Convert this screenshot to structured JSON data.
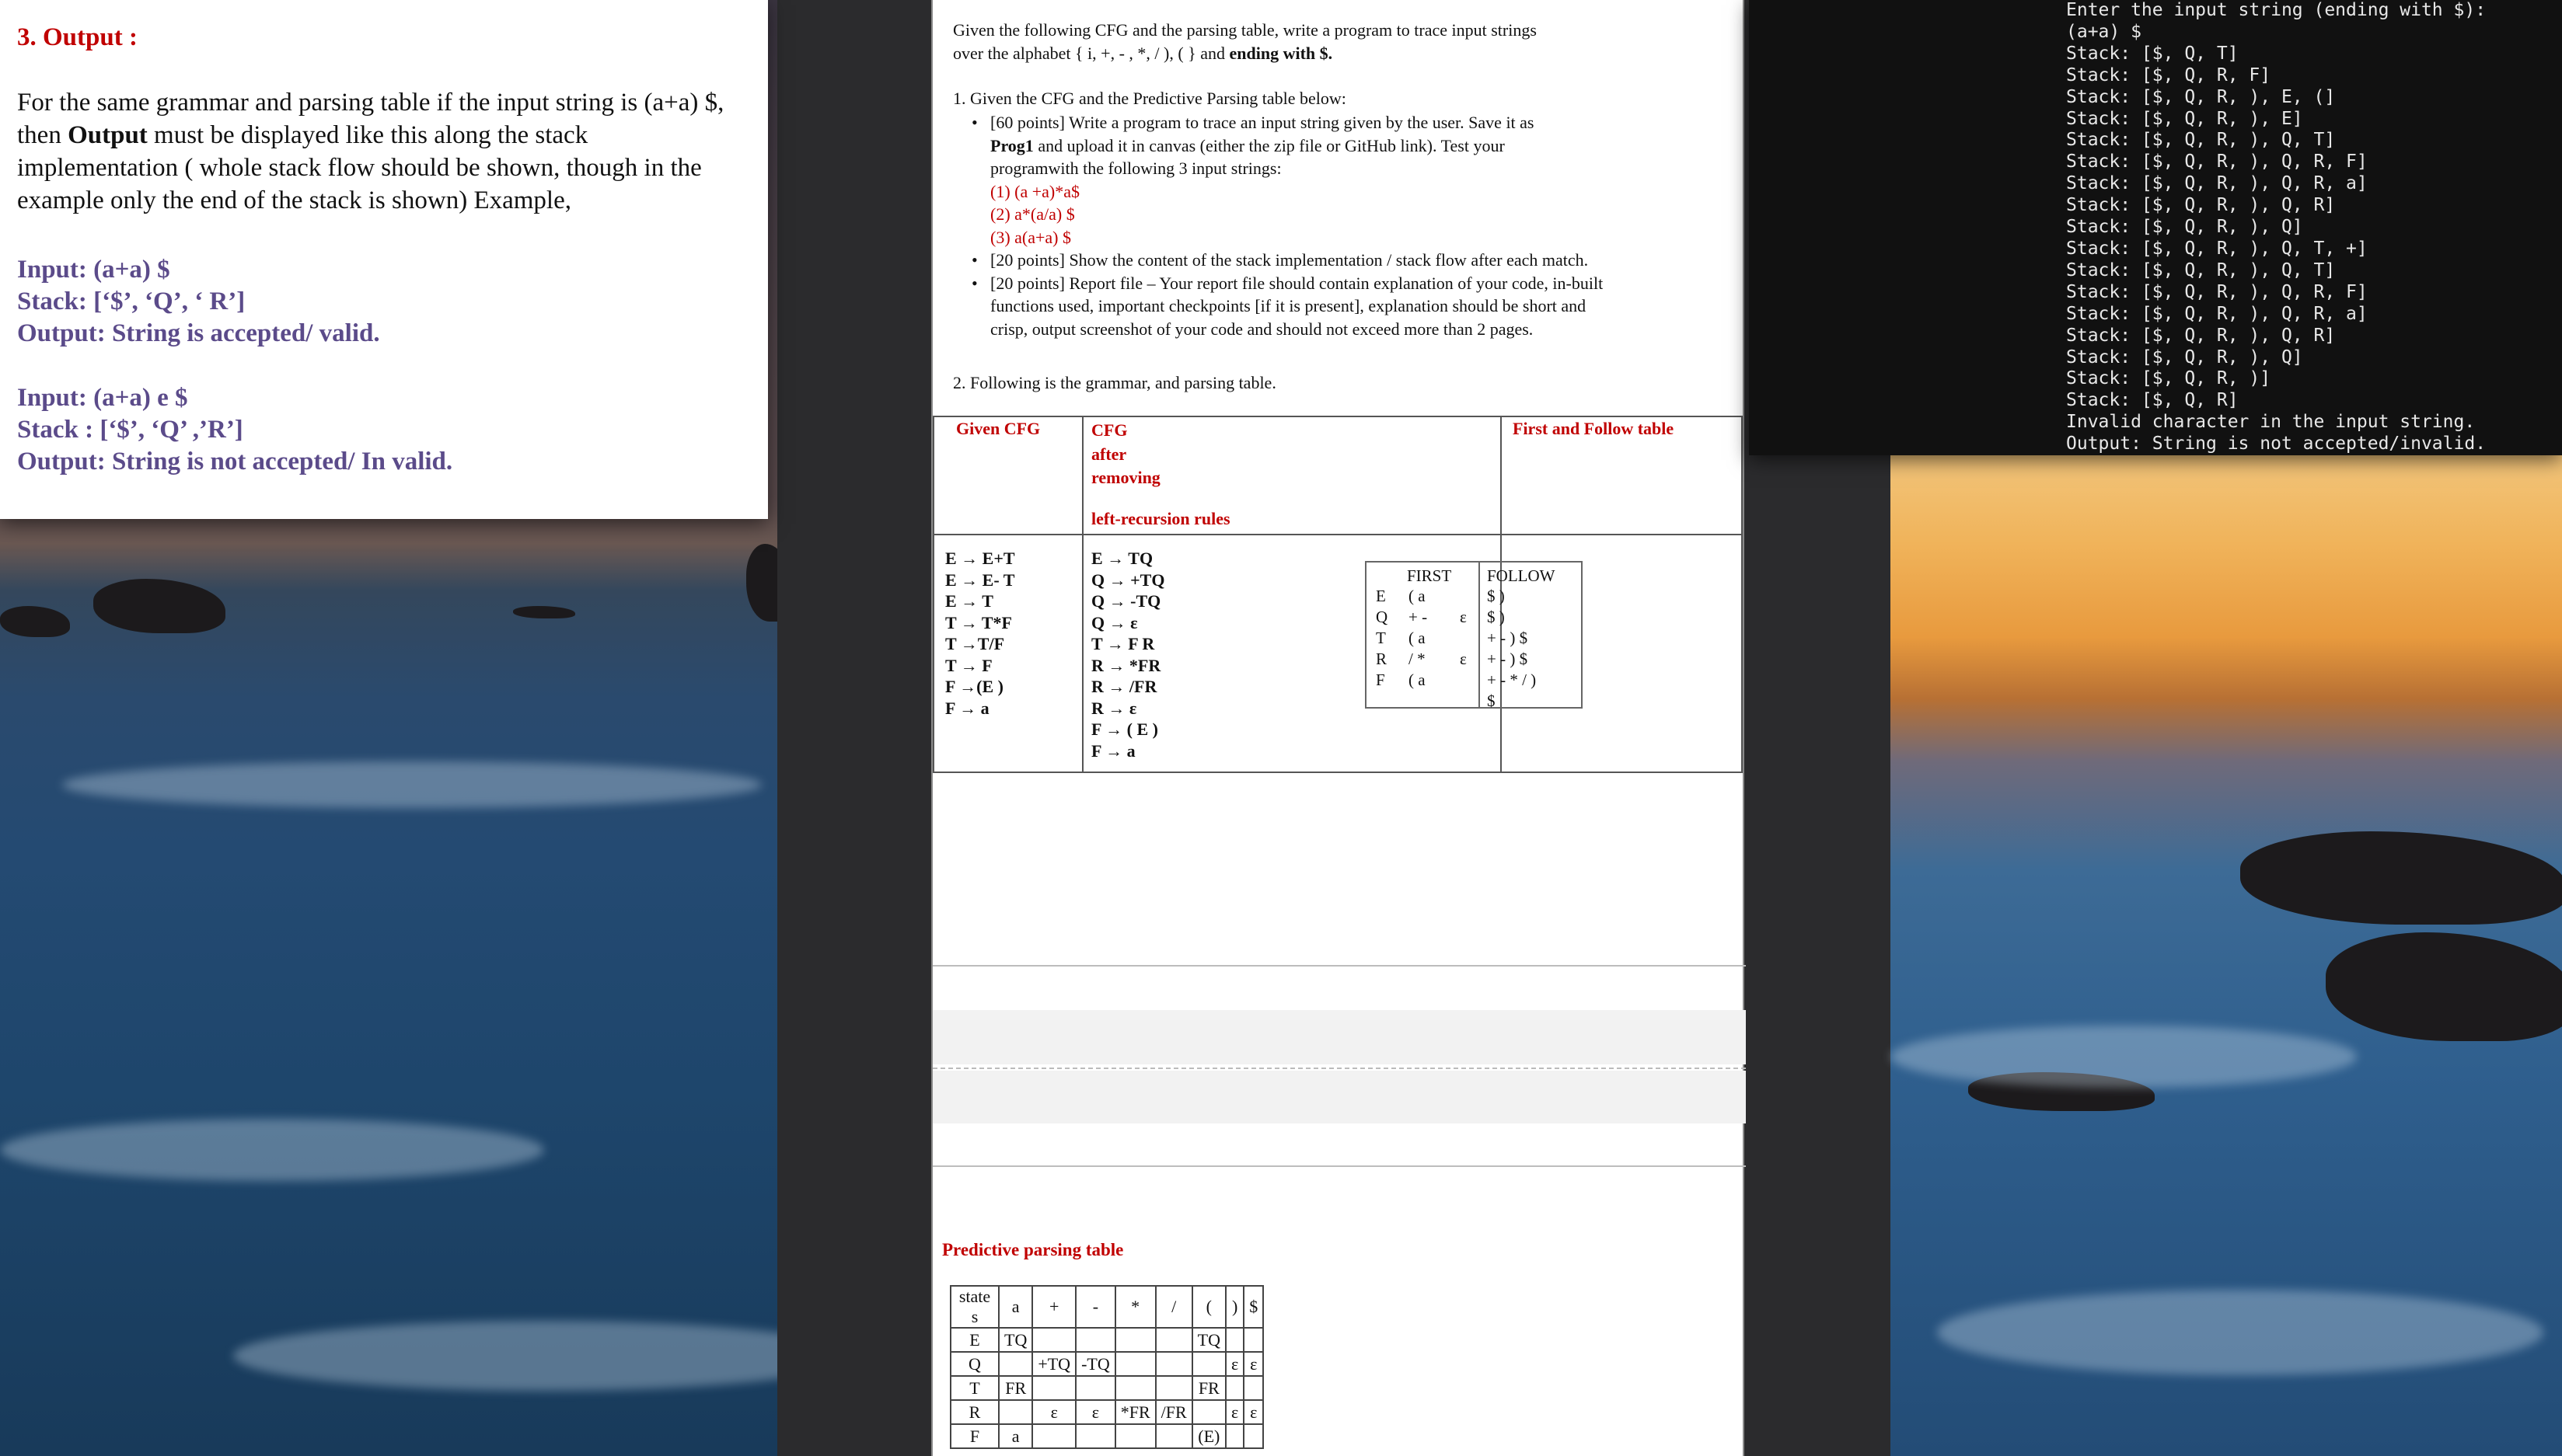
{
  "left_window": {
    "heading": "3. Output :",
    "paragraph_before": "For the same grammar and parsing table if the input string is (a+a) $, then ",
    "paragraph_bold": "Output",
    "paragraph_after": " must be displayed like this along the stack implementation ( whole stack flow should be shown, though in the example only the end of the stack is shown) Example,",
    "example1": {
      "input": "Input: (a+a) $",
      "stack": "Stack: [‘$’, ‘Q’, ‘ R’]",
      "output": "Output: String is accepted/ valid."
    },
    "example2": {
      "input": "Input: (a+a) e $",
      "stack": "Stack : [‘$’, ‘Q’ ,’R’]",
      "output": "Output: String is not accepted/ In valid."
    }
  },
  "document": {
    "intro_line1": "Given the following CFG and the parsing table, write a program to trace input strings",
    "intro_line2_pre": "over the alphabet { i, +, - , *, / ), ( } and ",
    "intro_line2_bold": "ending with $.",
    "q1_label": "1.  Given the CFG and the Predictive Parsing table below:",
    "bullet1_line1": "[60 points] Write a program to trace an input string given by the user. Save it as",
    "bullet1_line2_bold": "Prog1",
    "bullet1_line2_rest": " and upload it in canvas (either the zip file or GitHub link). Test your",
    "bullet1_line3": "programwith the following 3 input strings:",
    "test_strings": [
      "(1) (a +a)*a$",
      "(2) a*(a/a) $",
      "(3) a(a+a) $"
    ],
    "bullet2": "[20 points] Show the content of the stack implementation / stack flow after each match.",
    "bullet3_line1": "[20 points] Report file – Your report file should contain explanation of your code, in-built",
    "bullet3_line2": "functions used, important checkpoints [if it is present], explanation should be short and",
    "bullet3_line3": "crisp, output screenshot of your code and should not exceed more than 2 pages.",
    "q2_label": "2.  Following is the grammar, and parsing table.",
    "cfg_table": {
      "given_cfg_header": "Given CFG",
      "cfg_after_header": [
        "CFG",
        "after",
        "removing",
        "left-recursion rules"
      ],
      "ff_header": "First and Follow table",
      "given_cfg": [
        "E → E+T",
        "E → E- T",
        "E → T",
        "T → T*F",
        "T →T/F",
        "T → F",
        "F →(E )",
        "F → a"
      ],
      "cfg_after": [
        "E → TQ",
        "Q → +TQ",
        "Q → -TQ",
        "Q → ε",
        "T → F R",
        "R → *FR",
        "R → /FR",
        "R → ε",
        "F → ( E )",
        "F →  a"
      ],
      "ff_table": {
        "first_header": "FIRST",
        "follow_header": "FOLLOW",
        "nonterminals": [
          "E",
          "Q",
          "T",
          "R",
          "F"
        ],
        "first": [
          "( a",
          "+ -",
          "( a",
          "/ *",
          "( a"
        ],
        "first_eps": [
          "",
          "ε",
          "",
          "ε",
          ""
        ],
        "follow": [
          "$ )",
          "$ )",
          "+ - ) $",
          "+ - ) $",
          "+ - * / )",
          "$"
        ]
      }
    },
    "pp_title": "Predictive parsing table",
    "pp_table": {
      "header": [
        "state s",
        "a",
        "+",
        "-",
        "*",
        "/",
        "(",
        ")",
        "$"
      ],
      "rows": [
        [
          "E",
          "TQ",
          "",
          "",
          "",
          "",
          "TQ",
          "",
          ""
        ],
        [
          "Q",
          "",
          "+TQ",
          "-TQ",
          "",
          "",
          "",
          "ε",
          "ε"
        ],
        [
          "T",
          "FR",
          "",
          "",
          "",
          "",
          "FR",
          "",
          ""
        ],
        [
          "R",
          "",
          "ε",
          "ε",
          "*FR",
          "/FR",
          "",
          "ε",
          "ε"
        ],
        [
          "F",
          "a",
          "",
          "",
          "",
          "",
          "(E)",
          "",
          ""
        ]
      ]
    }
  },
  "terminal": {
    "lines": [
      "Enter the input string (ending with $):",
      "(a+a) $",
      "Stack: [$, Q, T]",
      "Stack: [$, Q, R, F]",
      "Stack: [$, Q, R, ), E, (]",
      "Stack: [$, Q, R, ), E]",
      "Stack: [$, Q, R, ), Q, T]",
      "Stack: [$, Q, R, ), Q, R, F]",
      "Stack: [$, Q, R, ), Q, R, a]",
      "Stack: [$, Q, R, ), Q, R]",
      "Stack: [$, Q, R, ), Q]",
      "Stack: [$, Q, R, ), Q, T, +]",
      "Stack: [$, Q, R, ), Q, T]",
      "Stack: [$, Q, R, ), Q, R, F]",
      "Stack: [$, Q, R, ), Q, R, a]",
      "Stack: [$, Q, R, ), Q, R]",
      "Stack: [$, Q, R, ), Q]",
      "Stack: [$, Q, R, )]",
      "Stack: [$, Q, R]",
      "Invalid character in the input string.",
      "Output: String is not accepted/invalid."
    ]
  }
}
